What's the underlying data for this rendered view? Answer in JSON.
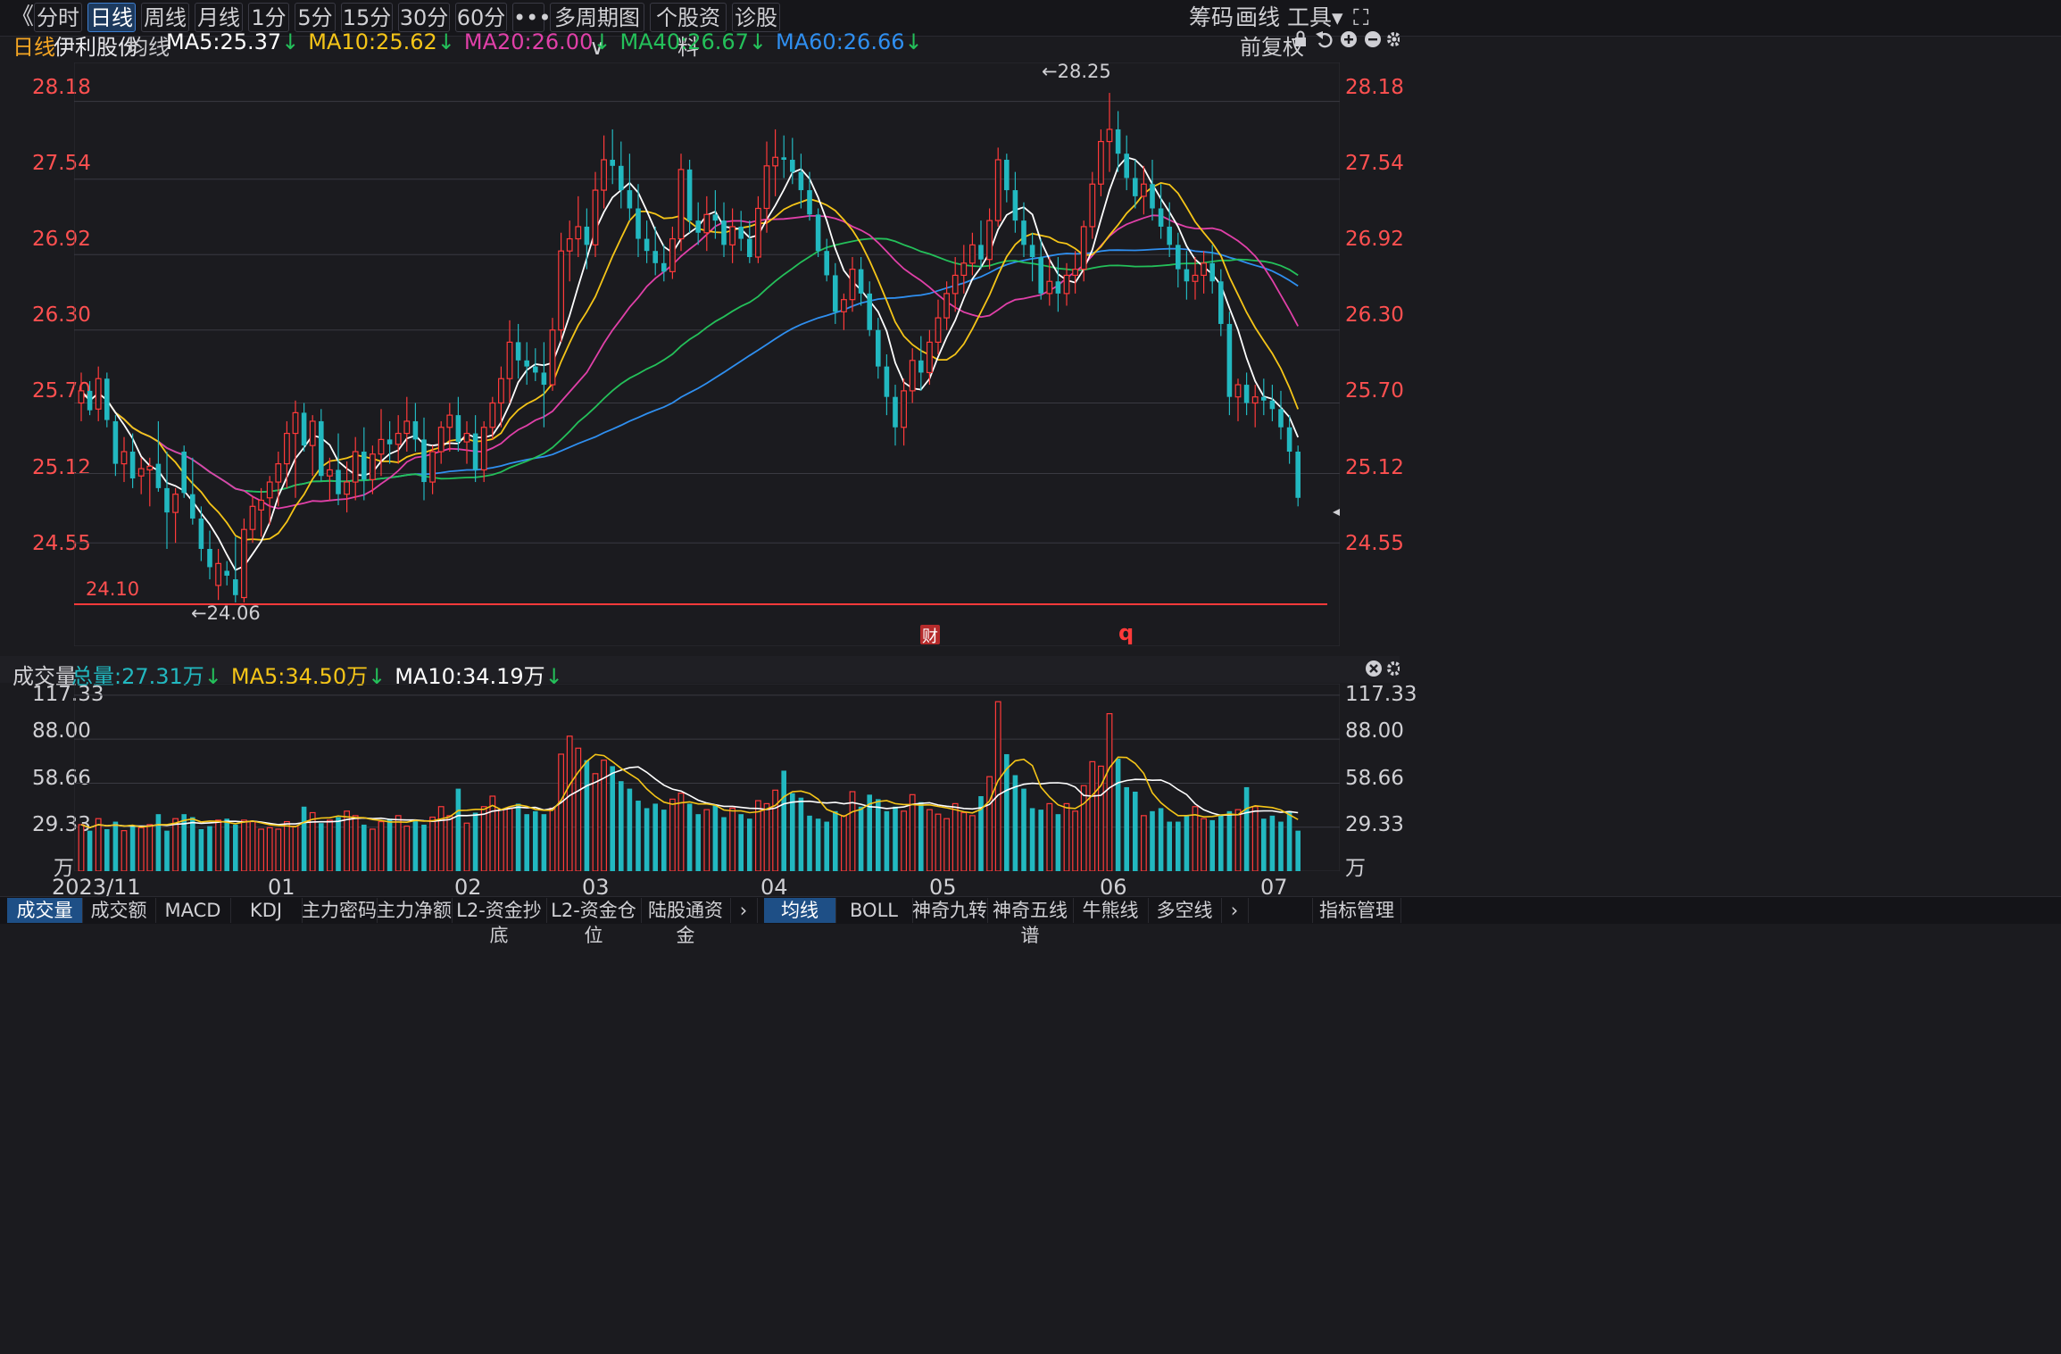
{
  "toolbar": {
    "back": "《",
    "tabs": [
      "分时",
      "日线",
      "周线",
      "月线",
      "1分",
      "5分",
      "15分",
      "30分",
      "60分",
      "•••",
      "多周期图 ∨",
      "个股资料",
      "诊股"
    ],
    "active_tab": 1,
    "right": [
      "筹码",
      "画线",
      "工具▾",
      "⛶"
    ]
  },
  "legend": {
    "period": "日线",
    "stock": "伊利股份",
    "ma_label": "均线",
    "ma": [
      {
        "text": "MA5:25.37",
        "color": "#ffffff"
      },
      {
        "text": "MA10:25.62",
        "color": "#f5c518"
      },
      {
        "text": "MA20:26.00",
        "color": "#e040a8"
      },
      {
        "text": "MA40:26.67",
        "color": "#24c05a"
      },
      {
        "text": "MA60:26.66",
        "color": "#2f8ff0"
      }
    ],
    "restore": "前复权",
    "icons": [
      "lock-icon",
      "undo-icon",
      "zoom-in-icon",
      "zoom-out-icon",
      "gear-icon"
    ]
  },
  "price_axis": [
    "28.18",
    "27.54",
    "26.92",
    "26.30",
    "25.70",
    "25.12",
    "24.55"
  ],
  "annotations": {
    "high": "←28.25",
    "low": "←24.06",
    "line_value": "24.10",
    "fin_badge": "财",
    "q_marker": "q"
  },
  "volume_legend": {
    "label": "成交量",
    "items": [
      {
        "text": "总量:27.31万",
        "color": "#22b8c0"
      },
      {
        "text": "MA5:34.50万",
        "color": "#f5c518"
      },
      {
        "text": "MA10:34.19万",
        "color": "#ffffff"
      }
    ]
  },
  "volume_axis": [
    "117.33",
    "88.00",
    "58.66",
    "29.33",
    "万"
  ],
  "x_labels": [
    "2023/11",
    "01",
    "02",
    "03",
    "04",
    "05",
    "06",
    "07"
  ],
  "bottom_tabs_left": [
    "成交量",
    "成交额",
    "MACD",
    "KDJ",
    "主力密码",
    "主力净额",
    "L2-资金抄底",
    "L2-资金仓位",
    "陆股通资金"
  ],
  "bottom_tabs_right": [
    "均线",
    "BOLL",
    "神奇九转",
    "神奇五线谱",
    "牛熊线",
    "多空线"
  ],
  "bottom_right": "指标管理",
  "colors": {
    "up": "#ff3a3a",
    "down": "#22b8c0",
    "ma5": "#ffffff",
    "ma10": "#f5c518",
    "ma20": "#e040a8",
    "ma40": "#24c05a",
    "ma60": "#2f8ff0"
  },
  "chart_data": {
    "type": "candlestick",
    "y_range": [
      23.7,
      28.5
    ],
    "volume_range": [
      0,
      125
    ],
    "candles": [
      [
        25.7,
        25.95,
        25.55,
        25.8,
        31
      ],
      [
        25.8,
        25.88,
        25.6,
        25.64,
        27
      ],
      [
        25.65,
        26.0,
        25.55,
        25.9,
        35
      ],
      [
        25.9,
        25.95,
        25.5,
        25.56,
        28
      ],
      [
        25.55,
        25.6,
        25.1,
        25.2,
        33
      ],
      [
        25.2,
        25.42,
        25.05,
        25.3,
        27
      ],
      [
        25.3,
        25.45,
        25.0,
        25.08,
        30
      ],
      [
        25.1,
        25.25,
        24.95,
        25.16,
        29
      ],
      [
        25.15,
        25.25,
        24.85,
        25.18,
        31
      ],
      [
        25.2,
        25.55,
        24.97,
        25.0,
        38
      ],
      [
        25.0,
        25.3,
        24.5,
        24.8,
        27
      ],
      [
        24.8,
        25.0,
        24.55,
        24.95,
        35
      ],
      [
        25.3,
        25.35,
        24.92,
        24.96,
        38
      ],
      [
        24.95,
        25.25,
        24.7,
        24.75,
        36
      ],
      [
        24.75,
        24.85,
        24.4,
        24.5,
        28
      ],
      [
        24.5,
        24.65,
        24.25,
        24.35,
        30
      ],
      [
        24.2,
        24.5,
        24.08,
        24.38,
        34
      ],
      [
        24.32,
        24.4,
        24.2,
        24.28,
        35
      ],
      [
        24.25,
        24.6,
        24.06,
        24.12,
        31
      ],
      [
        24.1,
        24.75,
        24.06,
        24.66,
        34
      ],
      [
        24.66,
        24.93,
        24.55,
        24.85,
        33
      ],
      [
        24.82,
        25.0,
        24.6,
        24.9,
        28
      ],
      [
        24.92,
        25.1,
        24.7,
        25.05,
        29
      ],
      [
        25.05,
        25.3,
        24.85,
        25.2,
        28
      ],
      [
        25.2,
        25.55,
        25.0,
        25.45,
        33
      ],
      [
        25.45,
        25.72,
        24.92,
        25.62,
        30
      ],
      [
        25.62,
        25.7,
        25.3,
        25.35,
        43
      ],
      [
        25.35,
        25.6,
        25.1,
        25.55,
        39
      ],
      [
        25.55,
        25.65,
        25.06,
        25.1,
        32
      ],
      [
        25.1,
        25.25,
        24.9,
        25.15,
        34
      ],
      [
        25.15,
        25.45,
        24.86,
        24.95,
        36
      ],
      [
        24.95,
        25.22,
        24.8,
        25.05,
        40
      ],
      [
        25.05,
        25.42,
        24.9,
        25.3,
        37
      ],
      [
        25.3,
        25.5,
        24.9,
        25.07,
        31
      ],
      [
        25.07,
        25.35,
        24.95,
        25.28,
        28
      ],
      [
        25.28,
        25.65,
        25.1,
        25.4,
        33
      ],
      [
        25.4,
        25.55,
        25.2,
        25.36,
        35
      ],
      [
        25.36,
        25.6,
        25.2,
        25.45,
        37
      ],
      [
        25.45,
        25.75,
        25.3,
        25.55,
        30
      ],
      [
        25.55,
        25.7,
        25.3,
        25.4,
        34
      ],
      [
        25.4,
        25.58,
        24.9,
        25.05,
        31
      ],
      [
        25.05,
        25.35,
        24.95,
        25.3,
        36
      ],
      [
        25.3,
        25.55,
        25.2,
        25.5,
        43
      ],
      [
        25.5,
        25.7,
        25.3,
        25.6,
        37
      ],
      [
        25.6,
        25.75,
        25.3,
        25.38,
        55
      ],
      [
        25.38,
        25.55,
        25.2,
        25.45,
        32
      ],
      [
        25.45,
        25.6,
        25.05,
        25.15,
        39
      ],
      [
        25.15,
        25.55,
        25.05,
        25.5,
        43
      ],
      [
        25.5,
        25.75,
        25.4,
        25.7,
        50
      ],
      [
        25.7,
        26.0,
        25.5,
        25.9,
        41
      ],
      [
        25.9,
        26.38,
        25.7,
        26.2,
        42
      ],
      [
        26.2,
        26.35,
        25.9,
        26.05,
        45
      ],
      [
        26.05,
        26.2,
        25.85,
        26.0,
        38
      ],
      [
        26.0,
        26.15,
        25.88,
        25.95,
        40
      ],
      [
        25.95,
        26.2,
        25.5,
        25.85,
        38
      ],
      [
        25.85,
        26.4,
        25.8,
        26.3,
        42
      ],
      [
        26.3,
        27.1,
        26.2,
        26.95,
        78
      ],
      [
        26.95,
        27.2,
        26.7,
        27.05,
        90
      ],
      [
        27.05,
        27.4,
        26.9,
        27.15,
        82
      ],
      [
        27.15,
        27.3,
        26.8,
        27.0,
        74
      ],
      [
        27.0,
        27.6,
        26.9,
        27.45,
        65
      ],
      [
        27.45,
        27.9,
        27.3,
        27.7,
        74
      ],
      [
        27.7,
        27.95,
        27.5,
        27.65,
        70
      ],
      [
        27.65,
        27.85,
        27.3,
        27.45,
        60
      ],
      [
        27.45,
        27.75,
        27.2,
        27.3,
        55
      ],
      [
        27.3,
        27.5,
        26.9,
        27.05,
        47
      ],
      [
        27.05,
        27.2,
        26.85,
        26.95,
        42
      ],
      [
        26.95,
        27.15,
        26.75,
        26.85,
        45
      ],
      [
        26.85,
        27.0,
        26.7,
        26.78,
        41
      ],
      [
        26.78,
        27.15,
        26.72,
        27.05,
        48
      ],
      [
        27.05,
        27.75,
        26.95,
        27.62,
        52
      ],
      [
        27.62,
        27.7,
        27.1,
        27.2,
        45
      ],
      [
        27.2,
        27.35,
        27.0,
        27.1,
        38
      ],
      [
        27.1,
        27.4,
        26.95,
        27.25,
        41
      ],
      [
        27.25,
        27.45,
        27.05,
        27.2,
        44
      ],
      [
        27.2,
        27.35,
        26.9,
        27.0,
        36
      ],
      [
        27.0,
        27.3,
        26.85,
        27.15,
        42
      ],
      [
        27.15,
        27.28,
        26.95,
        27.05,
        38
      ],
      [
        27.05,
        27.2,
        26.85,
        26.9,
        35
      ],
      [
        26.9,
        27.4,
        26.85,
        27.3,
        47
      ],
      [
        27.3,
        27.85,
        27.1,
        27.65,
        45
      ],
      [
        27.65,
        27.95,
        27.4,
        27.72,
        54
      ],
      [
        27.72,
        27.9,
        27.55,
        27.7,
        67
      ],
      [
        27.7,
        27.88,
        27.5,
        27.6,
        52
      ],
      [
        27.6,
        27.75,
        27.3,
        27.45,
        49
      ],
      [
        27.45,
        27.6,
        27.2,
        27.25,
        37
      ],
      [
        27.25,
        27.3,
        26.9,
        26.95,
        35
      ],
      [
        26.95,
        27.05,
        26.7,
        26.75,
        33
      ],
      [
        26.75,
        26.85,
        26.35,
        26.45,
        40
      ],
      [
        26.45,
        26.6,
        26.3,
        26.55,
        37
      ],
      [
        26.55,
        26.9,
        26.45,
        26.8,
        53
      ],
      [
        26.8,
        26.9,
        26.5,
        26.6,
        43
      ],
      [
        26.6,
        26.7,
        26.25,
        26.3,
        51
      ],
      [
        26.3,
        26.4,
        25.9,
        26.0,
        48
      ],
      [
        26.0,
        26.1,
        25.6,
        25.75,
        40
      ],
      [
        25.75,
        25.85,
        25.35,
        25.5,
        43
      ],
      [
        25.5,
        25.9,
        25.35,
        25.8,
        40
      ],
      [
        25.8,
        26.15,
        25.7,
        26.05,
        51
      ],
      [
        26.05,
        26.25,
        25.8,
        25.95,
        46
      ],
      [
        25.95,
        26.3,
        25.85,
        26.2,
        41
      ],
      [
        26.2,
        26.55,
        26.1,
        26.4,
        38
      ],
      [
        26.4,
        26.7,
        26.3,
        26.6,
        35
      ],
      [
        26.6,
        26.9,
        26.45,
        26.75,
        45
      ],
      [
        26.75,
        27.0,
        26.6,
        26.85,
        39
      ],
      [
        26.85,
        27.1,
        26.75,
        27.0,
        37
      ],
      [
        27.0,
        27.2,
        26.8,
        26.88,
        50
      ],
      [
        26.88,
        27.3,
        26.8,
        27.2,
        63
      ],
      [
        27.2,
        27.8,
        27.15,
        27.7,
        113
      ],
      [
        27.7,
        27.75,
        27.35,
        27.45,
        78
      ],
      [
        27.45,
        27.6,
        27.1,
        27.2,
        64
      ],
      [
        27.2,
        27.35,
        26.9,
        27.0,
        55
      ],
      [
        27.0,
        27.1,
        26.7,
        26.9,
        42
      ],
      [
        26.9,
        27.05,
        26.55,
        26.6,
        41
      ],
      [
        26.6,
        26.9,
        26.5,
        26.7,
        45
      ],
      [
        26.7,
        26.9,
        26.45,
        26.6,
        38
      ],
      [
        26.6,
        26.85,
        26.5,
        26.75,
        45
      ],
      [
        26.75,
        26.95,
        26.6,
        26.8,
        40
      ],
      [
        26.8,
        27.2,
        26.7,
        27.15,
        57
      ],
      [
        27.15,
        27.6,
        27.05,
        27.5,
        73
      ],
      [
        27.5,
        27.95,
        27.4,
        27.85,
        70
      ],
      [
        27.85,
        28.25,
        27.6,
        27.95,
        105
      ],
      [
        27.95,
        28.1,
        27.6,
        27.75,
        75
      ],
      [
        27.75,
        27.9,
        27.45,
        27.55,
        56
      ],
      [
        27.55,
        27.7,
        27.3,
        27.4,
        53
      ],
      [
        27.4,
        27.65,
        27.25,
        27.5,
        37
      ],
      [
        27.5,
        27.7,
        27.2,
        27.3,
        40
      ],
      [
        27.3,
        27.5,
        27.05,
        27.15,
        42
      ],
      [
        27.15,
        27.35,
        26.9,
        27.0,
        33
      ],
      [
        27.0,
        27.1,
        26.65,
        26.8,
        33
      ],
      [
        26.8,
        26.95,
        26.55,
        26.7,
        37
      ],
      [
        26.7,
        26.9,
        26.55,
        26.75,
        43
      ],
      [
        26.75,
        26.95,
        26.6,
        26.85,
        35
      ],
      [
        26.85,
        27.0,
        26.6,
        26.7,
        34
      ],
      [
        26.7,
        26.8,
        26.25,
        26.35,
        38
      ],
      [
        26.35,
        26.45,
        25.6,
        25.75,
        40
      ],
      [
        25.75,
        25.9,
        25.55,
        25.85,
        41
      ],
      [
        25.85,
        25.95,
        25.6,
        25.7,
        56
      ],
      [
        25.7,
        25.85,
        25.5,
        25.75,
        43
      ],
      [
        25.75,
        25.9,
        25.6,
        25.72,
        35
      ],
      [
        25.72,
        25.85,
        25.55,
        25.65,
        37
      ],
      [
        25.65,
        25.8,
        25.4,
        25.5,
        33
      ],
      [
        25.5,
        25.6,
        25.2,
        25.3,
        40
      ],
      [
        25.3,
        25.35,
        24.85,
        24.92,
        27
      ]
    ]
  }
}
